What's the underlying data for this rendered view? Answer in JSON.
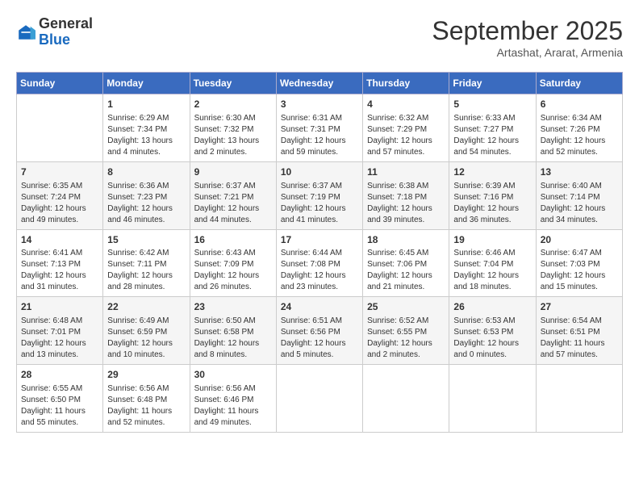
{
  "header": {
    "logo": {
      "general": "General",
      "blue": "Blue"
    },
    "month": "September 2025",
    "subtitle": "Artashat, Ararat, Armenia"
  },
  "days_of_week": [
    "Sunday",
    "Monday",
    "Tuesday",
    "Wednesday",
    "Thursday",
    "Friday",
    "Saturday"
  ],
  "weeks": [
    [
      {
        "day": "",
        "info": ""
      },
      {
        "day": "1",
        "info": "Sunrise: 6:29 AM\nSunset: 7:34 PM\nDaylight: 13 hours\nand 4 minutes."
      },
      {
        "day": "2",
        "info": "Sunrise: 6:30 AM\nSunset: 7:32 PM\nDaylight: 13 hours\nand 2 minutes."
      },
      {
        "day": "3",
        "info": "Sunrise: 6:31 AM\nSunset: 7:31 PM\nDaylight: 12 hours\nand 59 minutes."
      },
      {
        "day": "4",
        "info": "Sunrise: 6:32 AM\nSunset: 7:29 PM\nDaylight: 12 hours\nand 57 minutes."
      },
      {
        "day": "5",
        "info": "Sunrise: 6:33 AM\nSunset: 7:27 PM\nDaylight: 12 hours\nand 54 minutes."
      },
      {
        "day": "6",
        "info": "Sunrise: 6:34 AM\nSunset: 7:26 PM\nDaylight: 12 hours\nand 52 minutes."
      }
    ],
    [
      {
        "day": "7",
        "info": "Sunrise: 6:35 AM\nSunset: 7:24 PM\nDaylight: 12 hours\nand 49 minutes."
      },
      {
        "day": "8",
        "info": "Sunrise: 6:36 AM\nSunset: 7:23 PM\nDaylight: 12 hours\nand 46 minutes."
      },
      {
        "day": "9",
        "info": "Sunrise: 6:37 AM\nSunset: 7:21 PM\nDaylight: 12 hours\nand 44 minutes."
      },
      {
        "day": "10",
        "info": "Sunrise: 6:37 AM\nSunset: 7:19 PM\nDaylight: 12 hours\nand 41 minutes."
      },
      {
        "day": "11",
        "info": "Sunrise: 6:38 AM\nSunset: 7:18 PM\nDaylight: 12 hours\nand 39 minutes."
      },
      {
        "day": "12",
        "info": "Sunrise: 6:39 AM\nSunset: 7:16 PM\nDaylight: 12 hours\nand 36 minutes."
      },
      {
        "day": "13",
        "info": "Sunrise: 6:40 AM\nSunset: 7:14 PM\nDaylight: 12 hours\nand 34 minutes."
      }
    ],
    [
      {
        "day": "14",
        "info": "Sunrise: 6:41 AM\nSunset: 7:13 PM\nDaylight: 12 hours\nand 31 minutes."
      },
      {
        "day": "15",
        "info": "Sunrise: 6:42 AM\nSunset: 7:11 PM\nDaylight: 12 hours\nand 28 minutes."
      },
      {
        "day": "16",
        "info": "Sunrise: 6:43 AM\nSunset: 7:09 PM\nDaylight: 12 hours\nand 26 minutes."
      },
      {
        "day": "17",
        "info": "Sunrise: 6:44 AM\nSunset: 7:08 PM\nDaylight: 12 hours\nand 23 minutes."
      },
      {
        "day": "18",
        "info": "Sunrise: 6:45 AM\nSunset: 7:06 PM\nDaylight: 12 hours\nand 21 minutes."
      },
      {
        "day": "19",
        "info": "Sunrise: 6:46 AM\nSunset: 7:04 PM\nDaylight: 12 hours\nand 18 minutes."
      },
      {
        "day": "20",
        "info": "Sunrise: 6:47 AM\nSunset: 7:03 PM\nDaylight: 12 hours\nand 15 minutes."
      }
    ],
    [
      {
        "day": "21",
        "info": "Sunrise: 6:48 AM\nSunset: 7:01 PM\nDaylight: 12 hours\nand 13 minutes."
      },
      {
        "day": "22",
        "info": "Sunrise: 6:49 AM\nSunset: 6:59 PM\nDaylight: 12 hours\nand 10 minutes."
      },
      {
        "day": "23",
        "info": "Sunrise: 6:50 AM\nSunset: 6:58 PM\nDaylight: 12 hours\nand 8 minutes."
      },
      {
        "day": "24",
        "info": "Sunrise: 6:51 AM\nSunset: 6:56 PM\nDaylight: 12 hours\nand 5 minutes."
      },
      {
        "day": "25",
        "info": "Sunrise: 6:52 AM\nSunset: 6:55 PM\nDaylight: 12 hours\nand 2 minutes."
      },
      {
        "day": "26",
        "info": "Sunrise: 6:53 AM\nSunset: 6:53 PM\nDaylight: 12 hours\nand 0 minutes."
      },
      {
        "day": "27",
        "info": "Sunrise: 6:54 AM\nSunset: 6:51 PM\nDaylight: 11 hours\nand 57 minutes."
      }
    ],
    [
      {
        "day": "28",
        "info": "Sunrise: 6:55 AM\nSunset: 6:50 PM\nDaylight: 11 hours\nand 55 minutes."
      },
      {
        "day": "29",
        "info": "Sunrise: 6:56 AM\nSunset: 6:48 PM\nDaylight: 11 hours\nand 52 minutes."
      },
      {
        "day": "30",
        "info": "Sunrise: 6:56 AM\nSunset: 6:46 PM\nDaylight: 11 hours\nand 49 minutes."
      },
      {
        "day": "",
        "info": ""
      },
      {
        "day": "",
        "info": ""
      },
      {
        "day": "",
        "info": ""
      },
      {
        "day": "",
        "info": ""
      }
    ]
  ]
}
